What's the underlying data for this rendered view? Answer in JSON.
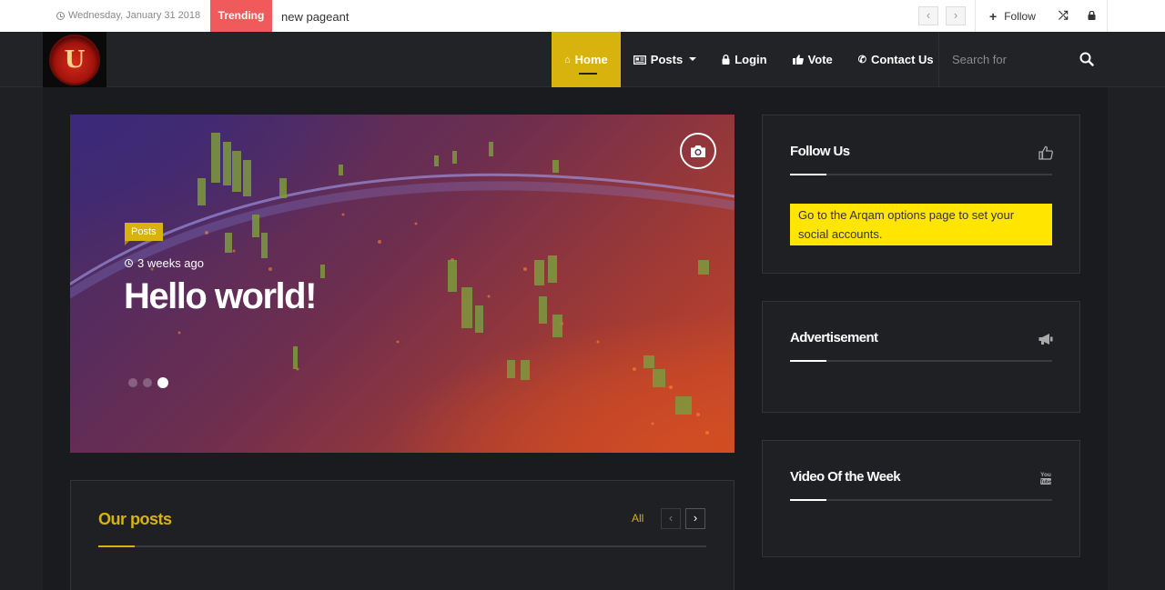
{
  "topbar": {
    "date": "Wednesday, January 31 2018",
    "trending_label": "Trending",
    "trending_text": "new pageant",
    "prev_icon": "‹",
    "next_icon": "›",
    "follow_label": "Follow",
    "icons": [
      "clock-icon",
      "chevron-left-icon",
      "chevron-right-icon",
      "plus-icon",
      "random-icon",
      "lock-icon"
    ]
  },
  "header": {
    "logo_letter": "U",
    "nav": [
      {
        "label": "Home",
        "icon": "home-icon",
        "active": true
      },
      {
        "label": "Posts",
        "icon": "newspaper-icon",
        "has_dropdown": true
      },
      {
        "label": "Login",
        "icon": "lock-icon"
      },
      {
        "label": "Vote",
        "icon": "thumbs-up-icon"
      },
      {
        "label": "Contact Us",
        "icon": "phone-icon"
      }
    ],
    "search_placeholder": "Search for"
  },
  "hero": {
    "category": "Posts",
    "time_ago": "3 weeks ago",
    "title": "Hello world!",
    "active_slide": 3,
    "slide_count": 3
  },
  "posts_block": {
    "title": "Our posts",
    "all_label": "All",
    "prev_icon": "‹",
    "next_icon": "›"
  },
  "sidebar": {
    "widgets": [
      {
        "title": "Follow Us",
        "icon": "thumbs-up-icon",
        "notice": "Go to the Arqam options page to set your social accounts."
      },
      {
        "title": "Advertisement",
        "icon": "bullhorn-icon"
      },
      {
        "title": "Video Of the Week",
        "icon": "youtube-icon"
      }
    ]
  },
  "colors": {
    "accent": "#d8b20d",
    "trending": "#f15a5a",
    "notice_bg": "#ffe500",
    "dark_bg": "#1f2024"
  }
}
